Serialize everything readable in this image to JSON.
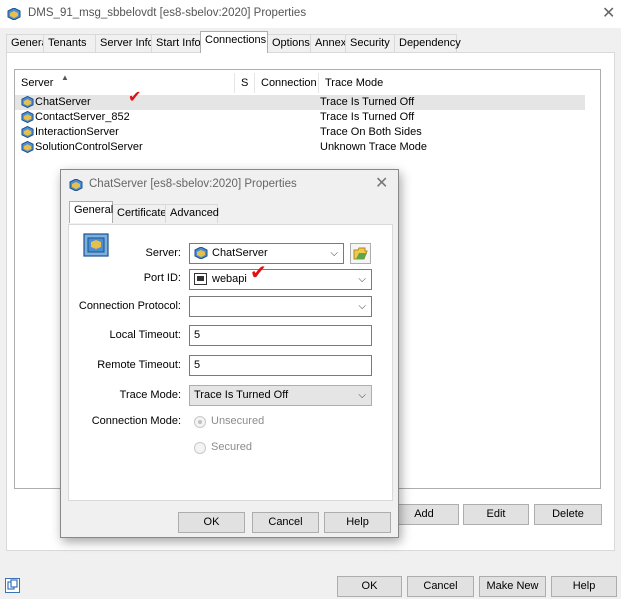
{
  "window": {
    "title": "DMS_91_msg_sbbelovdt [es8-sbelov:2020] Properties",
    "close_glyph": "✕",
    "icon": "server-icon"
  },
  "tabs": [
    {
      "label": "General"
    },
    {
      "label": "Tenants"
    },
    {
      "label": "Server Info"
    },
    {
      "label": "Start Info"
    },
    {
      "label": "Connections",
      "active": true
    },
    {
      "label": "Options"
    },
    {
      "label": "Annex"
    },
    {
      "label": "Security"
    },
    {
      "label": "Dependency"
    }
  ],
  "connections": {
    "sort_glyph": "▲",
    "columns": {
      "server": "Server",
      "s": "S",
      "connection": "Connection ...",
      "trace_mode": "Trace Mode"
    },
    "rows": [
      {
        "server": "ChatServer",
        "trace_mode": "Trace Is Turned Off",
        "selected": true
      },
      {
        "server": "ContactServer_852",
        "trace_mode": "Trace Is Turned Off"
      },
      {
        "server": "InteractionServer",
        "trace_mode": "Trace On Both Sides"
      },
      {
        "server": "SolutionControlServer",
        "trace_mode": "Unknown Trace Mode"
      }
    ],
    "buttons": {
      "add": "Add",
      "edit": "Edit",
      "delete": "Delete"
    }
  },
  "footer": {
    "ok": "OK",
    "cancel": "Cancel",
    "make_new": "Make New",
    "help": "Help",
    "icon": "copy-icon"
  },
  "dialog": {
    "title": "ChatServer [es8-sbelov:2020] Properties",
    "close_glyph": "✕",
    "tabs": [
      {
        "label": "General",
        "active": true
      },
      {
        "label": "Certificate"
      },
      {
        "label": "Advanced"
      }
    ],
    "labels": {
      "server": "Server:",
      "port_id": "Port ID:",
      "connection_protocol": "Connection Protocol:",
      "local_timeout": "Local Timeout:",
      "remote_timeout": "Remote Timeout:",
      "trace_mode": "Trace Mode:",
      "connection_mode": "Connection Mode:"
    },
    "values": {
      "server": "ChatServer",
      "port_id": "webapi",
      "connection_protocol": "",
      "local_timeout": "5",
      "remote_timeout": "5",
      "trace_mode": "Trace Is Turned Off"
    },
    "connection_mode_options": [
      {
        "label": "Unsecured",
        "checked": true
      },
      {
        "label": "Secured",
        "checked": false
      }
    ],
    "buttons": {
      "ok": "OK",
      "cancel": "Cancel",
      "help": "Help"
    }
  },
  "annotations": {
    "checkmark_glyph": "✔",
    "color": "#e01010"
  },
  "colors": {
    "selection": "#e5e5e5",
    "accent_blue": "#3a72b8",
    "annotation_red": "#e01010"
  }
}
